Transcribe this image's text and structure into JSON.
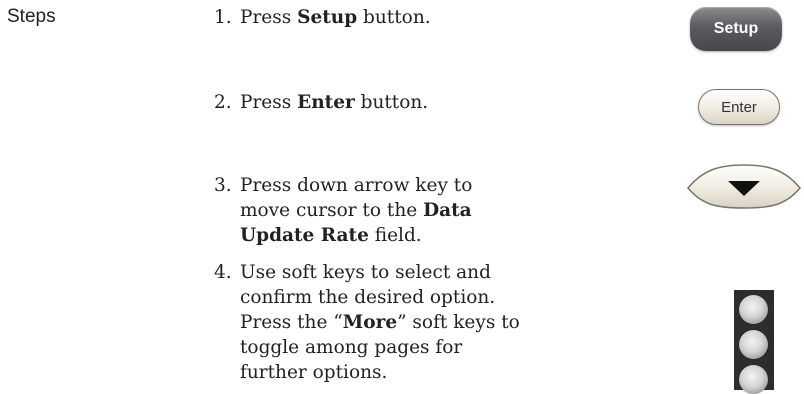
{
  "section_label": "Steps",
  "steps": [
    {
      "number": "1.",
      "parts": [
        "Press ",
        "Setup",
        " button."
      ]
    },
    {
      "number": "2.",
      "parts": [
        "Press ",
        "Enter",
        " button."
      ]
    },
    {
      "number": "3.",
      "parts": [
        "Press down arrow key to move cursor to the ",
        "Data Update Rate",
        " field."
      ]
    },
    {
      "number": "4.",
      "parts": [
        "Use soft keys to select and confirm the desired option. Press the “",
        "More",
        "” soft keys to toggle among pages for further options."
      ]
    }
  ],
  "buttons": {
    "setup_label": "Setup",
    "enter_label": "Enter",
    "down_arrow_icon": "down-arrow-icon",
    "soft_key_count": 3
  }
}
